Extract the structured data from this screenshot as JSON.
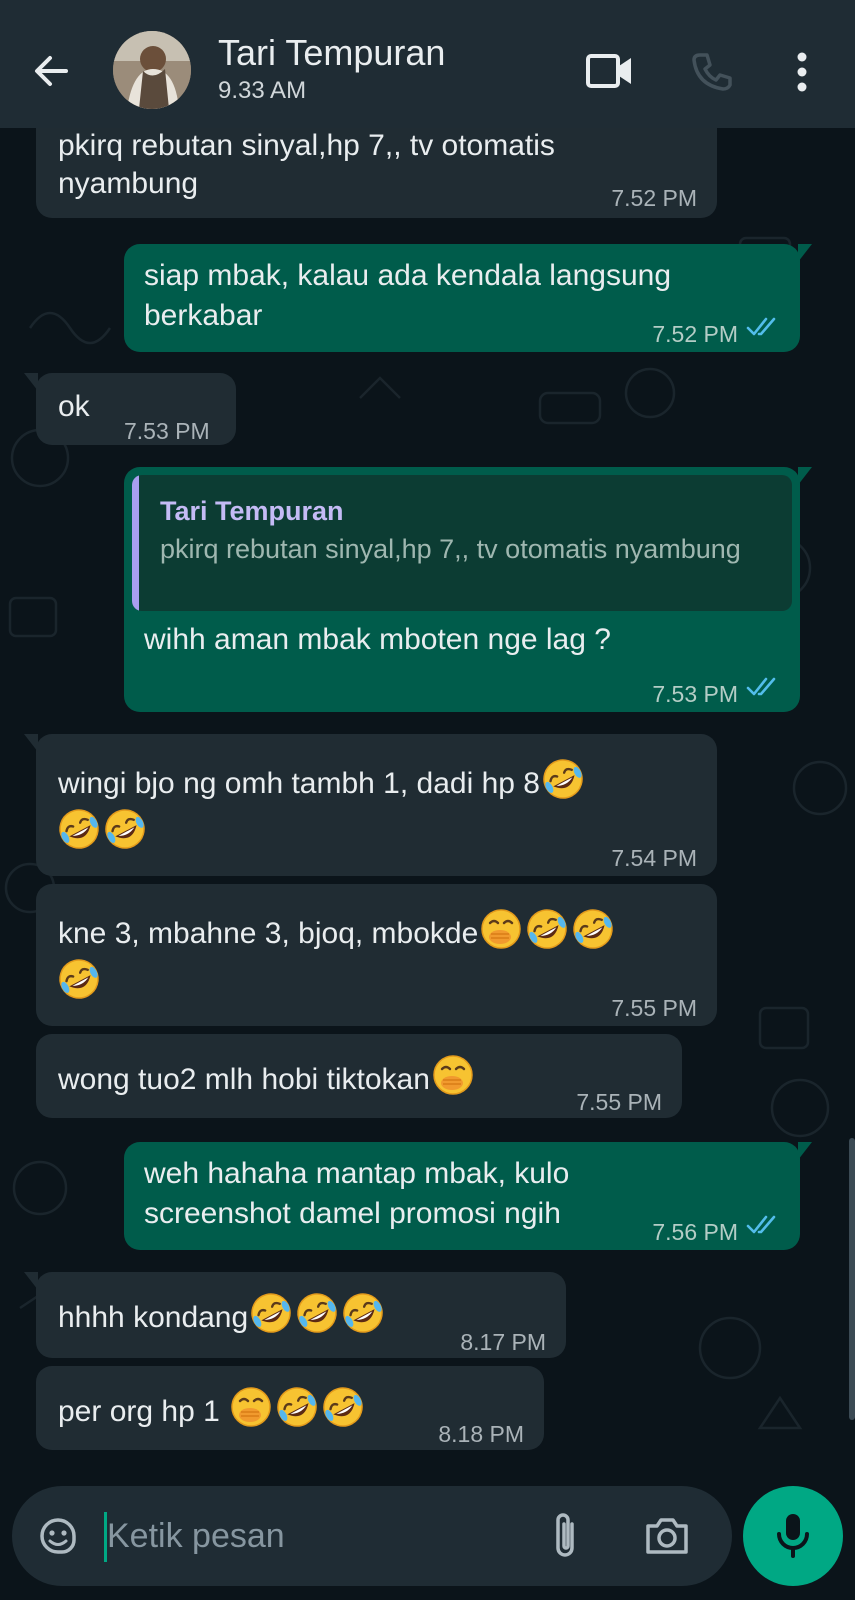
{
  "header": {
    "contact_name": "Tari Tempuran",
    "last_seen": "9.33 AM",
    "icons": [
      "back-arrow-icon",
      "video-call-icon",
      "voice-call-icon",
      "more-options-icon"
    ]
  },
  "messages": [
    {
      "direction": "incoming",
      "text": "pkirq rebutan sinyal,hp 7,, tv otomatis",
      "text2": "nyambung",
      "time": "7.52 PM"
    },
    {
      "direction": "outgoing",
      "text": "siap mbak, kalau ada kendala langsung",
      "text2": "berkabar",
      "time": "7.52 PM",
      "status": "read"
    },
    {
      "direction": "incoming",
      "text": "ok",
      "time": "7.53 PM"
    },
    {
      "direction": "outgoing",
      "reply_to": {
        "name": "Tari Tempuran",
        "text": "pkirq rebutan sinyal,hp 7,, tv otomatis nyambung"
      },
      "text": "wihh aman mbak mboten nge lag ?",
      "time": "7.53 PM",
      "status": "read"
    },
    {
      "direction": "incoming",
      "text": "wingi bjo ng omh tambh 1, dadi hp 8",
      "emoji": [
        "rolling-on-floor-laughing",
        "rolling-on-floor-laughing",
        "rolling-on-floor-laughing"
      ],
      "time": "7.54 PM"
    },
    {
      "direction": "incoming",
      "text": "kne 3, mbahne 3, bjoq, mbokde",
      "emoji": [
        "face-with-hand-over-mouth",
        "rolling-on-floor-laughing",
        "rolling-on-floor-laughing",
        "rolling-on-floor-laughing"
      ],
      "time": "7.55 PM"
    },
    {
      "direction": "incoming",
      "text": "wong tuo2 mlh hobi tiktokan",
      "emoji": [
        "face-with-hand-over-mouth"
      ],
      "time": "7.55 PM"
    },
    {
      "direction": "outgoing",
      "text": "weh hahaha mantap mbak, kulo",
      "text2": "screenshot damel promosi ngih",
      "time": "7.56 PM",
      "status": "read"
    },
    {
      "direction": "incoming",
      "text": "hhhh kondang",
      "emoji": [
        "rolling-on-floor-laughing",
        "rolling-on-floor-laughing",
        "rolling-on-floor-laughing"
      ],
      "time": "8.17 PM"
    },
    {
      "direction": "incoming",
      "text": "per org hp 1 ",
      "emoji": [
        "face-with-hand-over-mouth",
        "rolling-on-floor-laughing",
        "rolling-on-floor-laughing"
      ],
      "time": "8.18 PM"
    }
  ],
  "composer": {
    "placeholder": "Ketik pesan",
    "icons": [
      "sticker-icon",
      "attachment-icon",
      "camera-icon",
      "microphone-icon"
    ]
  },
  "colors": {
    "background": "#0b141a",
    "header": "#1f2c34",
    "incoming_bubble": "#202c33",
    "outgoing_bubble": "#005c4b",
    "accent": "#00a884",
    "read_ticks": "#53bdeb"
  }
}
